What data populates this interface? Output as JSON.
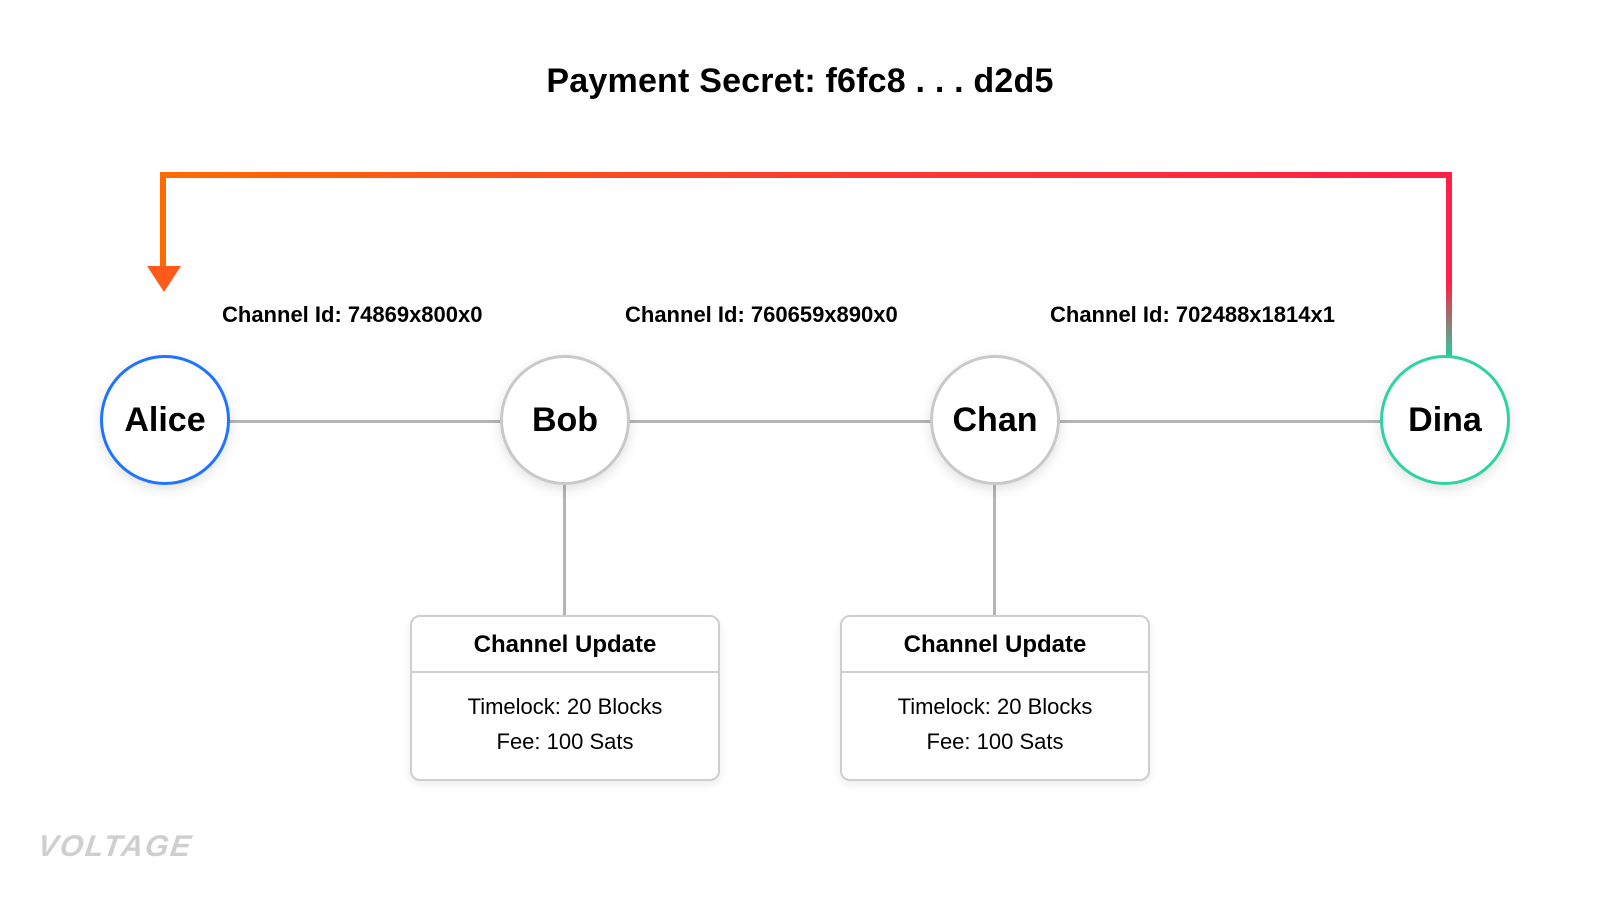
{
  "title": "Payment Secret: f6fc8 . . . d2d5",
  "channels": {
    "ab": "Channel Id: 74869x800x0",
    "bc": "Channel Id: 760659x890x0",
    "cd": "Channel Id: 702488x1814x1"
  },
  "nodes": {
    "alice": "Alice",
    "bob": "Bob",
    "chan": "Chan",
    "dina": "Dina"
  },
  "updates": {
    "bob": {
      "title": "Channel Update",
      "timelock": "Timelock: 20 Blocks",
      "fee": "Fee: 100 Sats"
    },
    "chan": {
      "title": "Channel Update",
      "timelock": "Timelock: 20 Blocks",
      "fee": "Fee: 100 Sats"
    }
  },
  "logo": "VOLTAGE"
}
